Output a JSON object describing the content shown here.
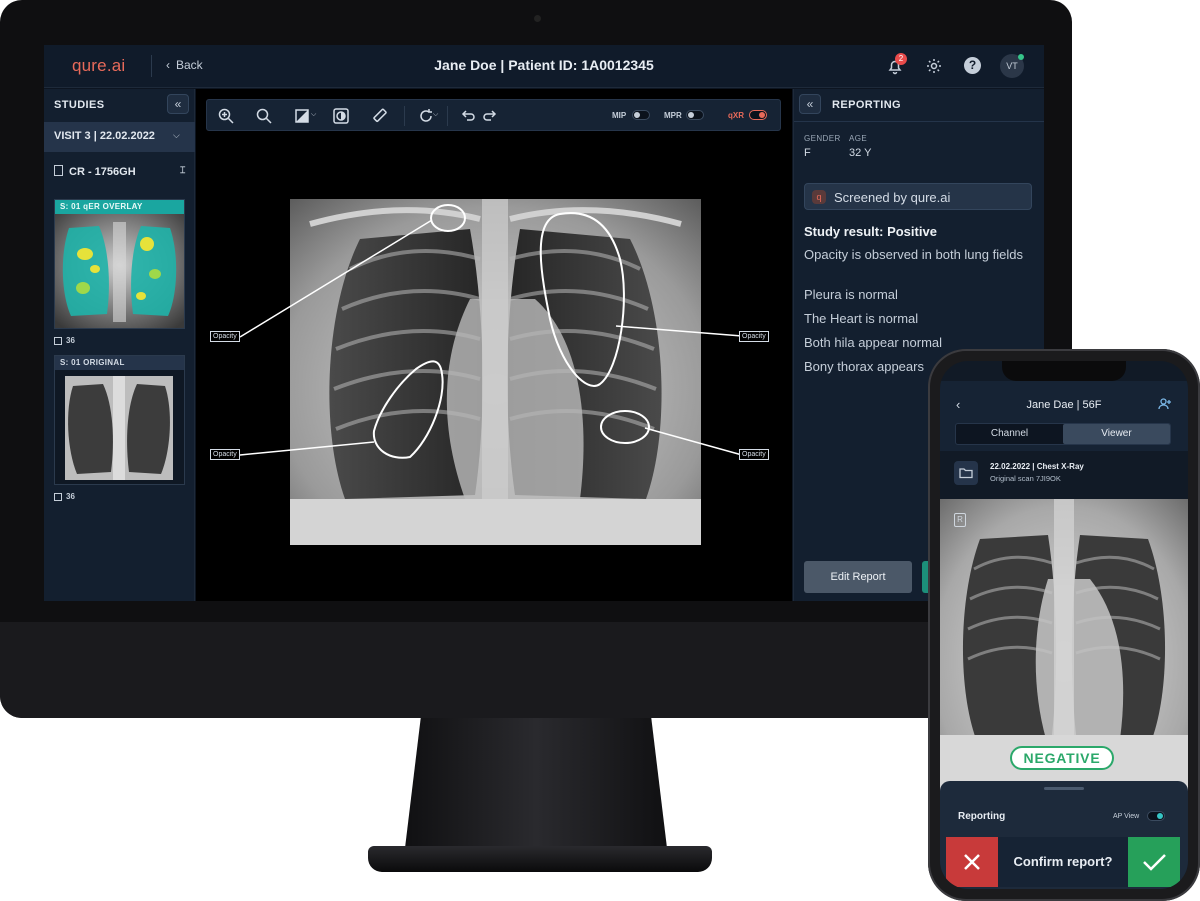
{
  "app": {
    "logo": "qure.ai",
    "back_label": "Back",
    "title": "Jane Doe | Patient ID: 1A0012345",
    "notification_count": "2",
    "avatar_initials": "VT",
    "help_glyph": "?"
  },
  "studies": {
    "title": "STUDIES",
    "collapse_glyph": "«",
    "visit": "VISIT 3 | 22.02.2022",
    "series": "CR - 1756GH",
    "thumbnails": [
      {
        "label": "S: 01  qER OVERLAY",
        "count": "36"
      },
      {
        "label": "S: 01  ORIGINAL",
        "count": "36"
      }
    ]
  },
  "viewer": {
    "toggles": [
      {
        "label": "MIP",
        "on": false
      },
      {
        "label": "MPR",
        "on": false
      },
      {
        "label": "qXR",
        "on": true
      }
    ],
    "annotations": [
      "Opacity",
      "Opacity",
      "Opacity",
      "Opacity"
    ]
  },
  "reporting": {
    "title": "REPORTING",
    "collapse_glyph": "«",
    "gender_label": "GENDER",
    "gender": "F",
    "age_label": "AGE",
    "age": "32 Y",
    "screened_icon": "q",
    "screened_by": "Screened by qure.ai",
    "result": "Study result: Positive",
    "findings": [
      "Opacity is observed in both lung fields",
      "Pleura is normal",
      "The Heart is normal",
      "Both hila appear normal",
      "Bony thorax appears"
    ],
    "edit_button": "Edit Report"
  },
  "phone": {
    "title": "Jane Dae  |  56F",
    "tabs": [
      "Channel",
      "Viewer"
    ],
    "study_title": "22.02.2022 | Chest X-Ray",
    "study_sub": "Original scan 7JI9OK",
    "marker": "R",
    "result_badge": "NEGATIVE",
    "sheet_title": "Reporting",
    "ap_view_label": "AP View",
    "confirm_text": "Confirm report?"
  },
  "colors": {
    "accent": "#e86a5a",
    "teal": "#1c8f7a",
    "positive_green": "#2ba86a",
    "reject_red": "#c83a3a"
  }
}
